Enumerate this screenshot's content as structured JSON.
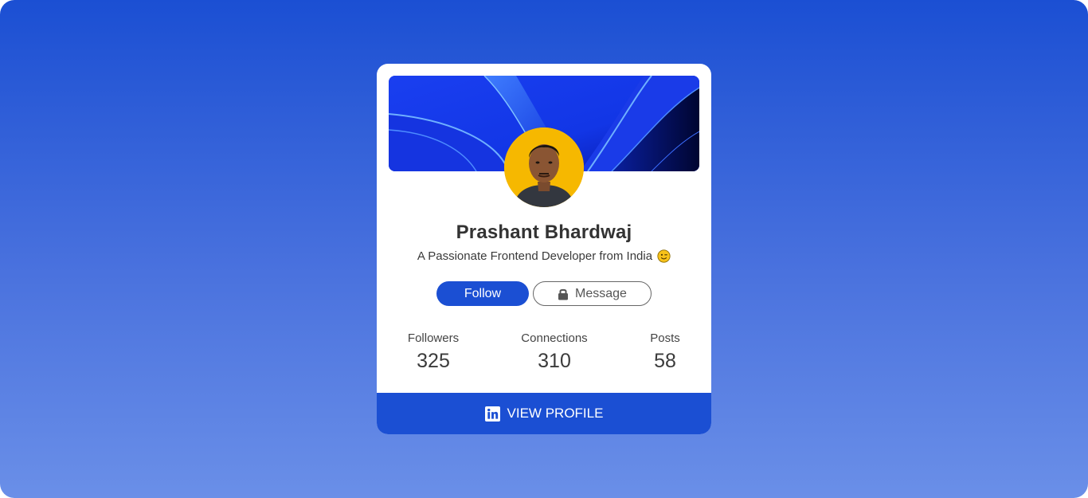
{
  "profile": {
    "name": "Prashant Bhardwaj",
    "tagline": "A Passionate Frontend Developer from India",
    "emoji": "winking-face-emoji"
  },
  "actions": {
    "follow_label": "Follow",
    "message_label": "Message"
  },
  "stats": [
    {
      "label": "Followers",
      "value": "325"
    },
    {
      "label": "Connections",
      "value": "310"
    },
    {
      "label": "Posts",
      "value": "58"
    }
  ],
  "footer": {
    "label": "VIEW PROFILE",
    "icon": "linkedin-icon"
  },
  "colors": {
    "background_top": "#1b4fd3",
    "background_bottom": "#6a8fe8",
    "accent": "#1b4fd3",
    "avatar_bg": "#f6b800",
    "text": "#333333"
  }
}
